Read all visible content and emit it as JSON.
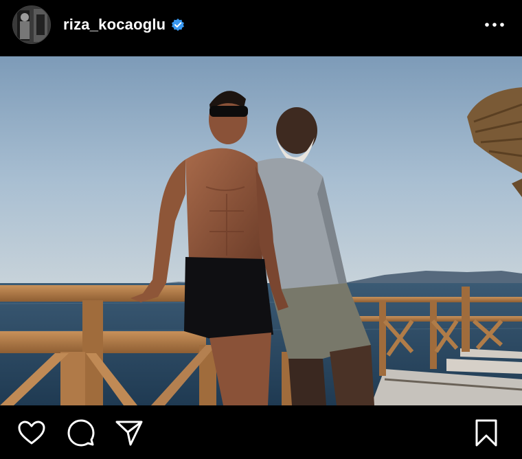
{
  "post": {
    "username": "riza_kocaoglu",
    "verified": true
  },
  "icons": {
    "avatar": "profile-avatar",
    "verified": "verified-badge-icon",
    "more": "more-options-icon",
    "like": "heart-icon",
    "comment": "comment-icon",
    "share": "share-icon",
    "save": "bookmark-icon"
  },
  "colors": {
    "background": "#000000",
    "text": "#ffffff",
    "verified": "#3897f0"
  }
}
